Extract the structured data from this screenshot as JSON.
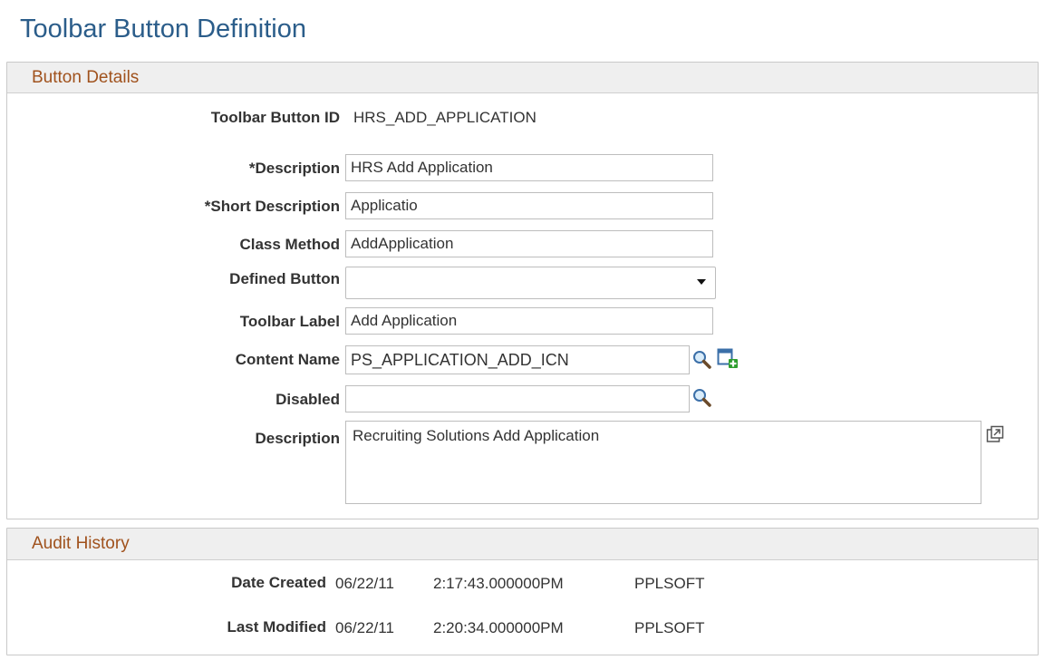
{
  "page": {
    "title": "Toolbar Button Definition"
  },
  "button_details": {
    "header": "Button Details",
    "toolbar_button_id": {
      "label": "Toolbar Button ID",
      "value": "HRS_ADD_APPLICATION"
    },
    "description": {
      "label": "*Description",
      "value": "HRS Add Application"
    },
    "short_description": {
      "label": "*Short Description",
      "value": "Applicatio"
    },
    "class_method": {
      "label": "Class Method",
      "value": "AddApplication"
    },
    "defined_button": {
      "label": "Defined Button",
      "value": ""
    },
    "toolbar_label": {
      "label": "Toolbar Label",
      "value": "Add Application"
    },
    "content_name": {
      "label": "Content Name",
      "value": "PS_APPLICATION_ADD_ICN"
    },
    "disabled": {
      "label": "Disabled",
      "value": ""
    },
    "long_description": {
      "label": "Description",
      "value": "Recruiting Solutions Add Application"
    }
  },
  "audit_history": {
    "header": "Audit History",
    "date_created": {
      "label": "Date Created",
      "date": "06/22/11",
      "time": "2:17:43.000000PM",
      "user": "PPLSOFT"
    },
    "last_modified": {
      "label": "Last Modified",
      "date": "06/22/11",
      "time": "2:20:34.000000PM",
      "user": "PPLSOFT"
    }
  },
  "icons": {
    "lookup": "magnifier-icon",
    "add_content": "add-content-icon",
    "expand": "expand-popup-icon"
  },
  "colors": {
    "title": "#2b5d8a",
    "section_header": "#a0521d",
    "section_bg": "#efefef"
  }
}
